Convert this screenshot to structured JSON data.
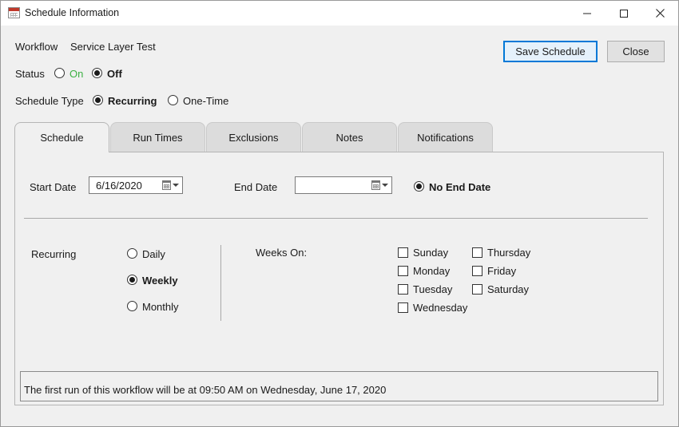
{
  "window": {
    "title": "Schedule Information",
    "controls": [
      "minimize-icon",
      "maximize-icon",
      "close-icon"
    ]
  },
  "header": {
    "workflow_label": "Workflow",
    "workflow_value": "Service Layer Test",
    "status_label": "Status",
    "status_on": "On",
    "status_off": "Off",
    "status_selected": "Off",
    "schedule_type_label": "Schedule Type",
    "type_recurring": "Recurring",
    "type_one_time": "One-Time",
    "type_selected": "Recurring",
    "save_button": "Save Schedule",
    "close_button": "Close"
  },
  "tabs": [
    {
      "label": "Schedule",
      "active": true
    },
    {
      "label": "Run Times",
      "active": false
    },
    {
      "label": "Exclusions",
      "active": false
    },
    {
      "label": "Notes",
      "active": false
    },
    {
      "label": "Notifications",
      "active": false
    }
  ],
  "schedule": {
    "start_date_label": "Start Date",
    "start_date_value": "6/16/2020",
    "end_date_label": "End Date",
    "end_date_value": "",
    "no_end_date_label": "No End Date",
    "no_end_date_checked": true,
    "recurring_label": "Recurring",
    "options": {
      "daily": "Daily",
      "weekly": "Weekly",
      "monthly": "Monthly"
    },
    "selected_option": "Weekly",
    "weeks_on_label": "Weeks On:",
    "days": {
      "sunday": "Sunday",
      "monday": "Monday",
      "tuesday": "Tuesday",
      "wednesday": "Wednesday",
      "thursday": "Thursday",
      "friday": "Friday",
      "saturday": "Saturday"
    },
    "info_text": "The first run of this workflow will be at 09:50 AM on Wednesday, June 17, 2020"
  },
  "colors": {
    "status_on": "#3cb043",
    "primary_button_border": "#0078d7",
    "primary_button_bg": "#e5f1fb"
  }
}
